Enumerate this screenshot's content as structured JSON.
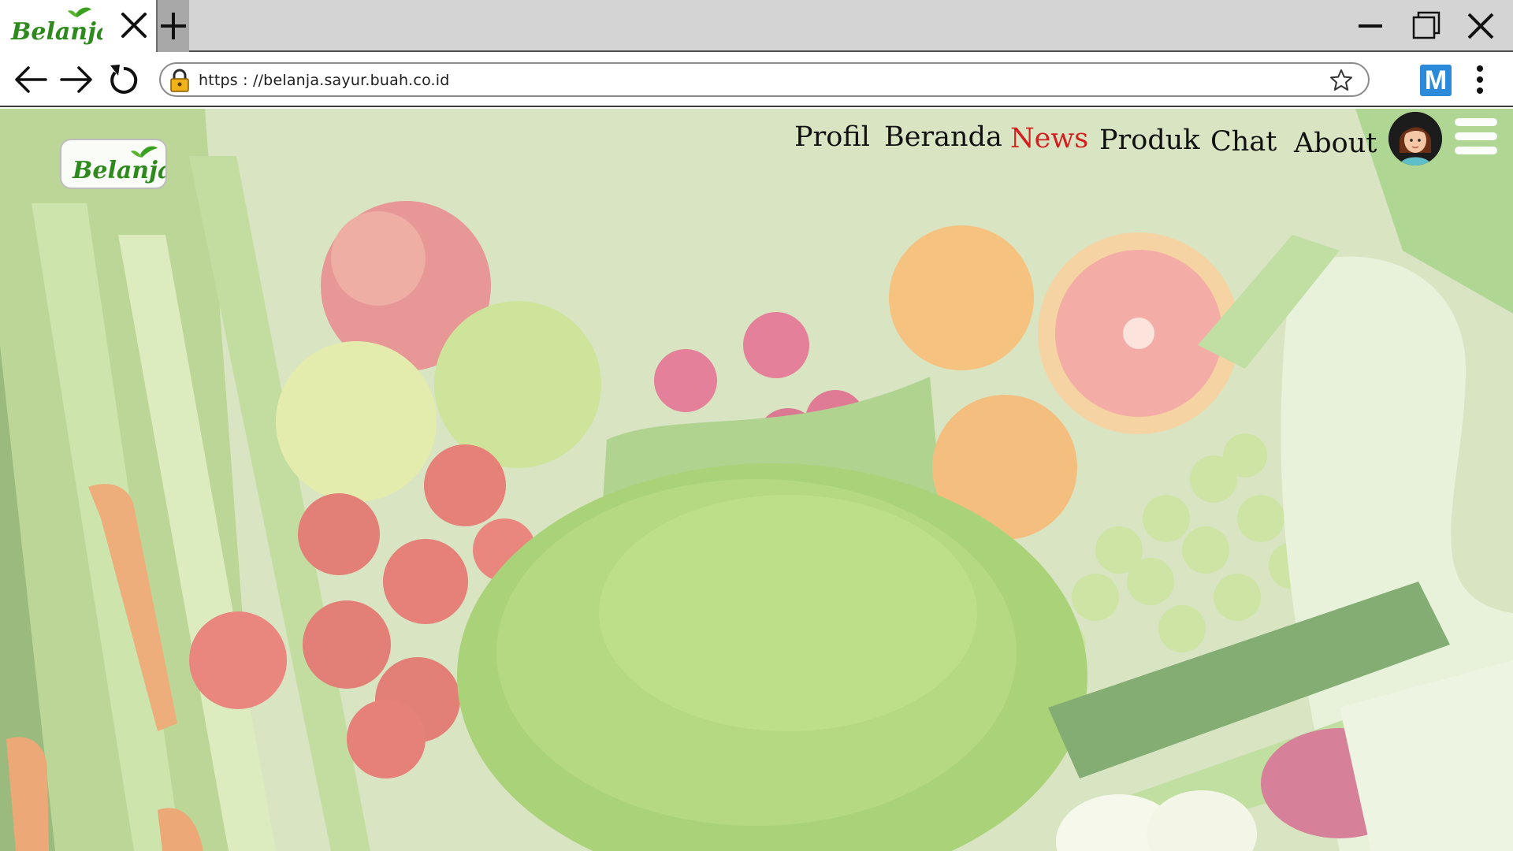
{
  "browser": {
    "tab": {
      "logo_text": "Belanja",
      "close_icon": "close-icon"
    },
    "new_tab_label": "+",
    "window_controls": [
      "minimize-icon",
      "restore-icon",
      "close-icon"
    ],
    "url": "https : //belanja.sayur.buah.co.id",
    "extension_label": "M"
  },
  "site": {
    "logo_text": "Belanja",
    "nav": [
      {
        "label": "Profil",
        "active": false
      },
      {
        "label": "Beranda",
        "active": false
      },
      {
        "label": "News",
        "active": true
      },
      {
        "label": "Produk",
        "active": false
      },
      {
        "label": "Chat",
        "active": false
      },
      {
        "label": "About",
        "active": false
      }
    ],
    "active_color": "#d21f1f",
    "hero": "fresh-vegetables-and-fruits-photo"
  },
  "colors": {
    "tabstrip": "#d4d4d4",
    "logo_green": "#2f8a1d",
    "extension_blue": "#2b8ad9"
  }
}
